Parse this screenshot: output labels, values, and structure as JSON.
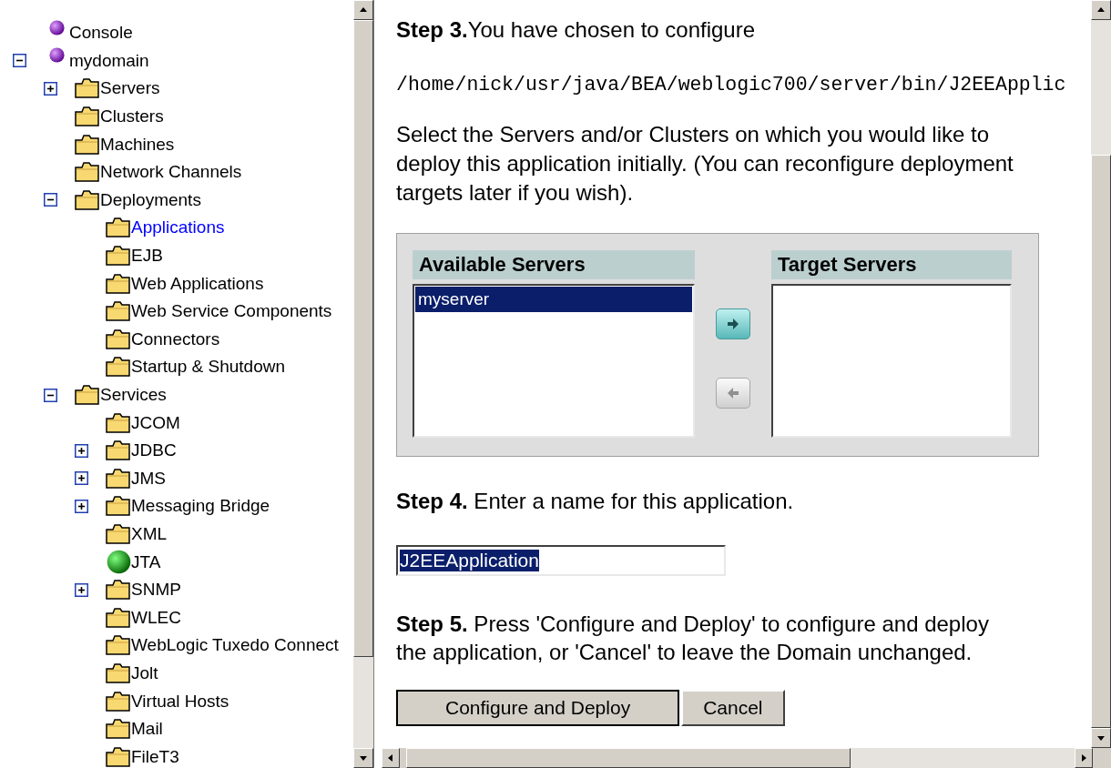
{
  "tree": [
    {
      "label": "Console",
      "kind": "domain",
      "selected": false
    },
    {
      "label": "mydomain",
      "kind": "domain",
      "expanded": true,
      "selected": false,
      "children": [
        {
          "label": "Servers",
          "kind": "folder",
          "expanded": false,
          "selected": false
        },
        {
          "label": "Clusters",
          "kind": "folder",
          "selected": false
        },
        {
          "label": "Machines",
          "kind": "folder",
          "selected": false
        },
        {
          "label": "Network Channels",
          "kind": "folder",
          "selected": false
        },
        {
          "label": "Deployments",
          "kind": "folder",
          "expanded": true,
          "selected": false,
          "children": [
            {
              "label": "Applications",
              "kind": "folder",
              "selected": true
            },
            {
              "label": "EJB",
              "kind": "folder",
              "selected": false
            },
            {
              "label": "Web Applications",
              "kind": "folder",
              "selected": false
            },
            {
              "label": "Web Service Components",
              "kind": "folder",
              "selected": false
            },
            {
              "label": "Connectors",
              "kind": "folder",
              "selected": false
            },
            {
              "label": "Startup & Shutdown",
              "kind": "folder",
              "selected": false
            }
          ]
        },
        {
          "label": "Services",
          "kind": "folder",
          "expanded": true,
          "selected": false,
          "children": [
            {
              "label": "JCOM",
              "kind": "folder",
              "selected": false
            },
            {
              "label": "JDBC",
              "kind": "folder",
              "expanded": false,
              "selected": false
            },
            {
              "label": "JMS",
              "kind": "folder",
              "expanded": false,
              "selected": false
            },
            {
              "label": "Messaging Bridge",
              "kind": "folder",
              "expanded": false,
              "selected": false
            },
            {
              "label": "XML",
              "kind": "folder",
              "selected": false
            },
            {
              "label": "JTA",
              "kind": "status",
              "selected": false
            },
            {
              "label": "SNMP",
              "kind": "folder",
              "expanded": false,
              "selected": false
            },
            {
              "label": "WLEC",
              "kind": "folder",
              "selected": false
            },
            {
              "label": "WebLogic Tuxedo Connect",
              "kind": "folder",
              "selected": false
            },
            {
              "label": "Jolt",
              "kind": "folder",
              "selected": false
            },
            {
              "label": "Virtual Hosts",
              "kind": "folder",
              "selected": false
            },
            {
              "label": "Mail",
              "kind": "folder",
              "selected": false
            },
            {
              "label": "FileT3",
              "kind": "folder",
              "selected": false
            }
          ]
        }
      ]
    }
  ],
  "content": {
    "step3": "**Step 3.**You have chosen to configure",
    "path": "/home/nick/usr/java/BEA/weblogic700/server/bin/J2EEApplic",
    "instructions": "Select the Servers and/or Clusters on which you would like to deploy this application initially. (You can reconfigure deployment targets later if you wish).",
    "server_picker": {
      "available": {
        "heading": "Available Servers",
        "items": [
          {
            "label": "myserver",
            "selected": true
          }
        ]
      },
      "move_buttons": [
        {
          "kind": "add",
          "disabled": false
        },
        {
          "kind": "remove",
          "disabled": true
        }
      ],
      "target": {
        "heading": "Target Servers"
      }
    },
    "step4": "**Step 4.** Enter a name for this application.",
    "name_field": {
      "value": "J2EEApplication",
      "highlighted": true
    },
    "step5": "**Step 5.** Press 'Configure and Deploy' to configure and deploy the application, or 'Cancel' to leave the Domain unchanged.",
    "buttons": [
      {
        "label": "Configure and Deploy",
        "default": true
      },
      {
        "label": "Cancel",
        "default": false
      }
    ]
  }
}
